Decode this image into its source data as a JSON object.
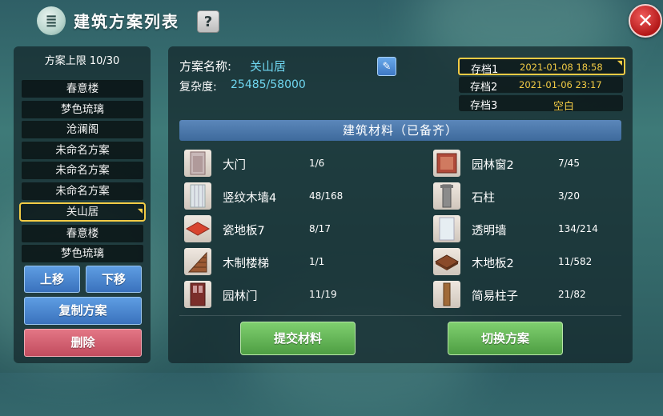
{
  "header": {
    "title": "建筑方案列表",
    "help_label": "?",
    "close_label": "✕"
  },
  "sidebar": {
    "limit_text": "方案上限 10/30",
    "plans": [
      {
        "label": "春意楼",
        "selected": false
      },
      {
        "label": "梦色琉璃",
        "selected": false
      },
      {
        "label": "沧澜阁",
        "selected": false
      },
      {
        "label": "未命名方案",
        "selected": false
      },
      {
        "label": "未命名方案",
        "selected": false
      },
      {
        "label": "未命名方案",
        "selected": false
      },
      {
        "label": "关山居",
        "selected": true
      },
      {
        "label": "春意楼",
        "selected": false
      },
      {
        "label": "梦色琉璃",
        "selected": false
      }
    ],
    "move_up_label": "上移",
    "move_down_label": "下移",
    "copy_label": "复制方案",
    "delete_label": "删除"
  },
  "plan": {
    "name_label": "方案名称:",
    "name_value": "关山居",
    "complexity_label": "复杂度:",
    "complexity_value": "25485/58000"
  },
  "saves": [
    {
      "name": "存档1",
      "date": "2021-01-08 18:58",
      "active": true
    },
    {
      "name": "存档2",
      "date": "2021-01-06 23:17",
      "active": false
    },
    {
      "name": "存档3",
      "date": "空白",
      "active": false
    }
  ],
  "materials_header": "建筑材料（已备齐）",
  "materials": [
    {
      "name": "大门",
      "count": "1/6",
      "icon": "door-icon"
    },
    {
      "name": "园林窗2",
      "count": "7/45",
      "icon": "window-icon"
    },
    {
      "name": "竖纹木墙4",
      "count": "48/168",
      "icon": "wood-wall-icon"
    },
    {
      "name": "石柱",
      "count": "3/20",
      "icon": "stone-pillar-icon"
    },
    {
      "name": "瓷地板7",
      "count": "8/17",
      "icon": "tile-floor-icon"
    },
    {
      "name": "透明墙",
      "count": "134/214",
      "icon": "glass-wall-icon"
    },
    {
      "name": "木制楼梯",
      "count": "1/1",
      "icon": "wooden-stairs-icon"
    },
    {
      "name": "木地板2",
      "count": "11/582",
      "icon": "wood-floor-icon"
    },
    {
      "name": "园林门",
      "count": "11/19",
      "icon": "garden-door-icon"
    },
    {
      "name": "简易柱子",
      "count": "21/82",
      "icon": "simple-pillar-icon"
    }
  ],
  "actions": {
    "submit_label": "提交材料",
    "switch_label": "切换方案"
  },
  "colors": {
    "accent_gold": "#f2cb45",
    "accent_cyan": "#6fd6f0",
    "blue_button": "#4a86d2",
    "red_button": "#d05d6f",
    "green_button": "#62b556"
  }
}
